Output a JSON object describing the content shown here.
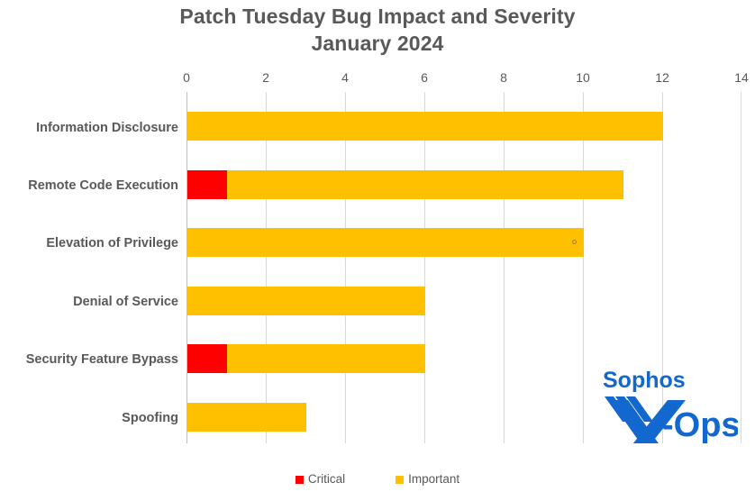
{
  "chart_data": {
    "type": "bar",
    "orientation": "horizontal",
    "stacked": true,
    "title": "Patch Tuesday Bug Impact and Severity",
    "subtitle": "January 2024",
    "xlabel": "",
    "ylabel": "",
    "xlim": [
      0,
      14
    ],
    "xticks": [
      0,
      2,
      4,
      6,
      8,
      10,
      12,
      14
    ],
    "grid": true,
    "legend_position": "bottom",
    "categories": [
      "Information Disclosure",
      "Remote Code Execution",
      "Elevation of Privilege",
      "Denial of Service",
      "Security Feature Bypass",
      "Spoofing"
    ],
    "series": [
      {
        "name": "Critical",
        "color": "#FF0000",
        "values": [
          0,
          1,
          0,
          0,
          1,
          0
        ]
      },
      {
        "name": "Important",
        "color": "#FFC000",
        "values": [
          12,
          10,
          10,
          6,
          5,
          3
        ]
      }
    ],
    "totals": [
      12,
      11,
      10,
      6,
      6,
      3
    ],
    "annotations": [
      {
        "name": "data-point-marker",
        "category": "Elevation of Privilege",
        "x": 9.8
      }
    ]
  },
  "axis": {
    "tick_labels": [
      "0",
      "2",
      "4",
      "6",
      "8",
      "10",
      "12",
      "14"
    ]
  },
  "legend": {
    "items": [
      {
        "label": "Critical",
        "color": "#FF0000"
      },
      {
        "label": "Important",
        "color": "#FFC000"
      }
    ]
  },
  "logo": {
    "brand": "Sophos",
    "product": "-Ops",
    "letter": "X",
    "color": "#1268CE"
  },
  "colors": {
    "critical": "#FF0000",
    "important": "#FFC000",
    "text": "#595959",
    "gridline": "#D9D9D9",
    "background": "#FFFFFF"
  }
}
